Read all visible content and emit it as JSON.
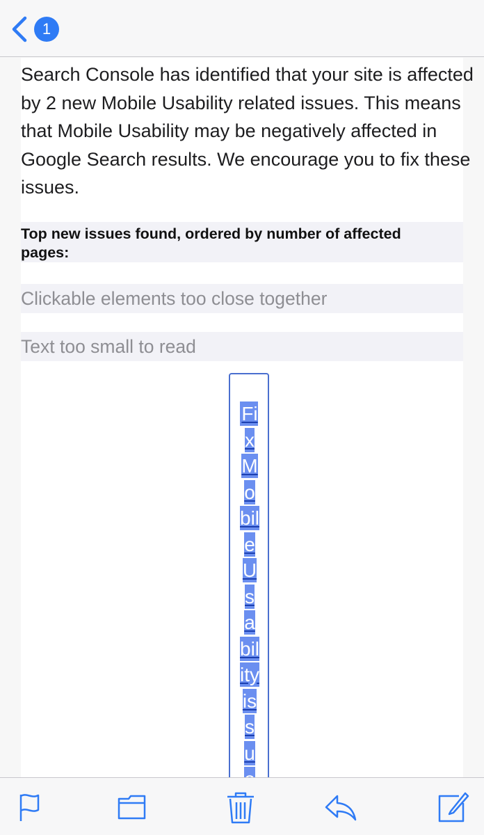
{
  "nav": {
    "unread_count": "1"
  },
  "email": {
    "body": "Search Console has identified that your site is affected by 2 new Mobile Usability related issues. This means that Mobile Usability may be negatively affected in Google Search results. We encourage you to fix these issues.",
    "issues_heading": "Top new issues found, ordered by number of affected pages:",
    "issues": [
      "Clickable elements too close together",
      "Text too small to read"
    ],
    "cta_label": "Fix Mobile Usability issues"
  },
  "toolbar": {
    "icons": [
      "flag-icon",
      "folder-icon",
      "trash-icon",
      "reply-icon",
      "compose-icon"
    ]
  },
  "colors": {
    "accent": "#2f7bf5",
    "muted_text": "#8e8e93",
    "cta_fill": "#6b8ff0"
  }
}
